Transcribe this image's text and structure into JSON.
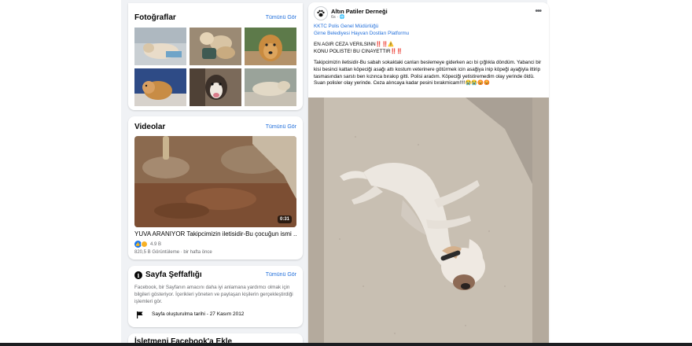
{
  "photos": {
    "title": "Fotoğraflar",
    "see_all": "Tümünü Gör"
  },
  "videos": {
    "title": "Videolar",
    "see_all": "Tümünü Gör",
    "duration": "0:31",
    "video_title": "YUVA ARANIYOR Takipcimizin iletisidir-Bu çocuğun ismi ...",
    "rating": "4.9 B",
    "views": "820,5 B Görüntüleme",
    "age": "bir hafta önce"
  },
  "transparency": {
    "title": "Sayfa Şeffaflığı",
    "see_all": "Tümünü Gör",
    "description": "Facebook, bir Sayfanın amacını daha iyi anlamana yardımcı olmak için bilgileri gösteriyor. İçerikleri yöneten ve paylaşan kişilerin gerçekleştirdiği işlemleri gör.",
    "created": "Sayfa oluşturulma tarihi - 27 Kasım 2012"
  },
  "next_card": {
    "title": "İşletmeni Facebook'a Ekle"
  },
  "post": {
    "page_name": "Altın Patiler Derneği",
    "time": "6s · ",
    "tag1": "KKTC Polis Genel Müdürlüğü",
    "tag2": "Girne Belediyesi Hayvan Dostları Platformu",
    "line1": "EN AGIR CEZA VERILSINN",
    "line1_marks": "‼️‼️⚠️",
    "line2": "KONU POLISTE! BU CINAYETTIR",
    "line2_marks": "‼️‼️",
    "message": "Takipcimizin iletisidir-Bu sabah sokaktaki canları beslemeye giderken acı bi çığlıkla döndüm. Yabanci bir kisi besinci kattan köpeciği asağı attı kostum veterinere götürmek icin asağiya inip köpeği ayağiyla ittirip tasmasından sarstı ben kızınca bırakıp gitti. Polisi aradım. Köpeciği yetistiremedim olay yerinde öldü. Suan polisler olay yerinde. Ceza alıncaya kadar pesini bırakmicam!!!!😭😭😡😡"
  },
  "colors": {
    "link": "#216fdb",
    "muted": "#65676b",
    "background": "#f0f2f5",
    "facebook_blue": "#1877f2"
  }
}
